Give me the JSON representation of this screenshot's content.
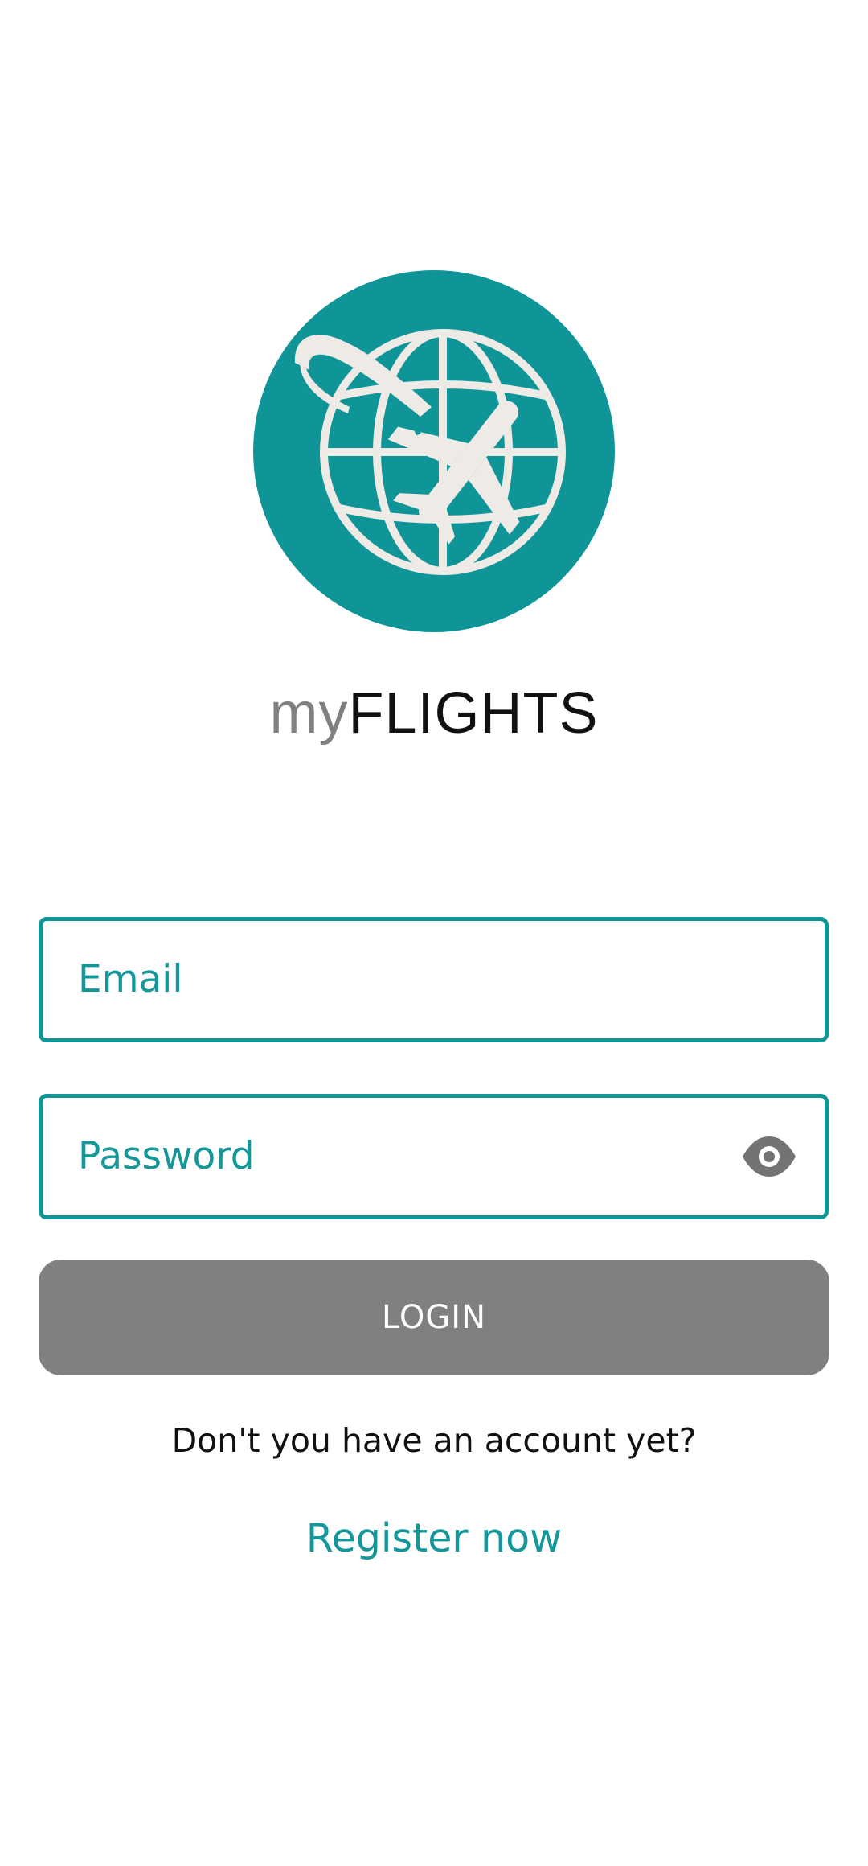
{
  "app": {
    "title_prefix": "my",
    "title_suffix": "FLIGHTS",
    "logo_icon": "globe-airplane-icon"
  },
  "form": {
    "email_placeholder": "Email",
    "password_placeholder": "Password",
    "password_toggle_icon": "eye-icon",
    "login_label": "LOGIN"
  },
  "footer": {
    "no_account_text": "Don't you have an account yet?",
    "register_label": "Register now"
  },
  "colors": {
    "brand_teal": "#0f9597",
    "logo_glyph": "#eeebe6",
    "button_gray": "#808080",
    "title_prefix_gray": "#808080"
  }
}
